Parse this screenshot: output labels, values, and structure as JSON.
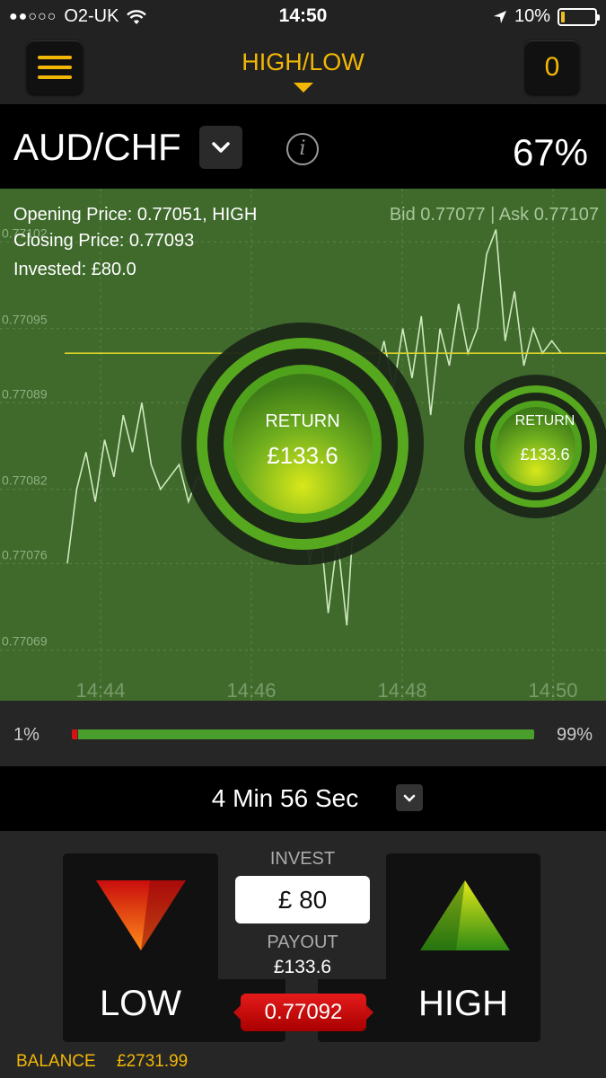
{
  "status_bar": {
    "signal_dots": "●●○○○",
    "carrier": "O2-UK",
    "time": "14:50",
    "battery": "10%",
    "battery_level": 0.1
  },
  "nav": {
    "title": "HIGH/LOW",
    "counter": "0"
  },
  "asset": {
    "name": "AUD/CHF",
    "payout_percent": "67%"
  },
  "chart_info": {
    "opening": "Opening Price: 0.77051, HIGH",
    "closing": "Closing Price: 0.77093",
    "invested": "Invested: £80.0",
    "bid_ask": "Bid 0.77077 | Ask 0.77107"
  },
  "chart_data": {
    "type": "line",
    "y_ticks": [
      "0.77102",
      "0.77095",
      "0.77089",
      "0.77082",
      "0.77076",
      "0.77069"
    ],
    "x_ticks": [
      "14:44",
      "14:46",
      "14:48",
      "14:50"
    ],
    "reference_line": 0.77093,
    "series": [
      {
        "values": [
          0.77076,
          0.77082,
          0.77085,
          0.77081,
          0.77086,
          0.77083,
          0.77088,
          0.77085,
          0.77089,
          0.77084,
          0.77082,
          0.77083,
          0.77084,
          0.77081,
          0.77083,
          0.77082,
          0.77085,
          0.77083,
          0.7708,
          0.77084,
          0.77081,
          0.77086,
          0.77082,
          0.7708,
          0.77078,
          0.77083,
          0.77076,
          0.7708,
          0.77072,
          0.77078,
          0.77071,
          0.77083,
          0.77079,
          0.77091,
          0.77094,
          0.7709,
          0.77095,
          0.77091,
          0.77096,
          0.77088,
          0.77095,
          0.77092,
          0.77097,
          0.77093,
          0.77095,
          0.77101,
          0.77103,
          0.77094,
          0.77098,
          0.77092,
          0.77095,
          0.77093,
          0.77094,
          0.77093
        ]
      }
    ]
  },
  "return_badges": [
    {
      "label": "RETURN",
      "value": "£133.6"
    },
    {
      "label": "RETURN",
      "value": "£133.6"
    }
  ],
  "progress": {
    "left_pct": "1%",
    "right_pct": "99%",
    "low_share": 0.01,
    "high_share": 0.99
  },
  "timer": {
    "text": "4 Min 56 Sec"
  },
  "trade": {
    "low_label": "LOW",
    "high_label": "HIGH",
    "invest_label": "INVEST",
    "invest_value": "£ 80",
    "payout_label": "PAYOUT",
    "payout_value": "£133.6",
    "current_price": "0.77092"
  },
  "balance": {
    "label": "BALANCE",
    "value": "£2731.99"
  },
  "colors": {
    "accent": "#f2b705",
    "chart_bg": "#3f6a2c",
    "high_green": "#4a9e2c",
    "low_red": "#d11111"
  }
}
